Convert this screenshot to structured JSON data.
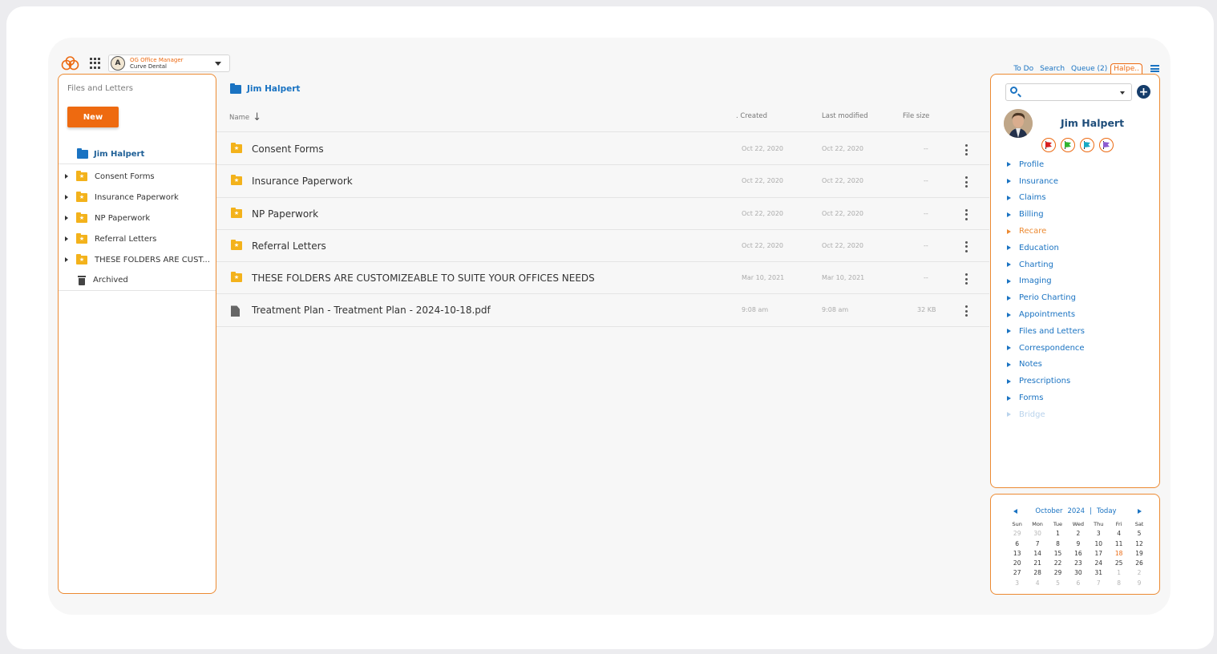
{
  "header": {
    "user_role": "OG Office Manager",
    "user_org": "Curve Dental",
    "avatar_initial": "A"
  },
  "top_links": {
    "todo": "To Do",
    "search": "Search",
    "queue": "Queue (2)",
    "patient_tab": "Halpe.."
  },
  "sidebar": {
    "title": "Files and Letters",
    "new_button": "New",
    "root": "Jim Halpert",
    "items": [
      {
        "label": "Consent Forms",
        "icon": "folder-star-icon"
      },
      {
        "label": "Insurance Paperwork",
        "icon": "folder-star-icon"
      },
      {
        "label": "NP Paperwork",
        "icon": "folder-star-icon"
      },
      {
        "label": "Referral Letters",
        "icon": "folder-star-icon"
      },
      {
        "label": "THESE FOLDERS ARE CUST...",
        "icon": "folder-star-icon"
      },
      {
        "label": "Archived",
        "icon": "trash-icon"
      }
    ]
  },
  "main": {
    "title": "Jim Halpert",
    "columns": {
      "name": "Name",
      "created": ". Created",
      "modified": "Last modified",
      "size": "File size"
    },
    "rows": [
      {
        "name": "Consent Forms",
        "created": "Oct 22, 2020",
        "modified": "Oct 22, 2020",
        "size": "--",
        "type": "folder"
      },
      {
        "name": "Insurance Paperwork",
        "created": "Oct 22, 2020",
        "modified": "Oct 22, 2020",
        "size": "--",
        "type": "folder"
      },
      {
        "name": "NP Paperwork",
        "created": "Oct 22, 2020",
        "modified": "Oct 22, 2020",
        "size": "--",
        "type": "folder"
      },
      {
        "name": "Referral Letters",
        "created": "Oct 22, 2020",
        "modified": "Oct 22, 2020",
        "size": "--",
        "type": "folder"
      },
      {
        "name": "THESE FOLDERS ARE CUSTOMIZEABLE TO SUITE YOUR OFFICES NEEDS",
        "created": "Mar 10, 2021",
        "modified": "Mar 10, 2021",
        "size": "--",
        "type": "folder"
      },
      {
        "name": "Treatment Plan - Treatment Plan - 2024-10-18.pdf",
        "created": "9:08 am",
        "modified": "9:08 am",
        "size": "32 KB",
        "type": "file"
      }
    ]
  },
  "patient": {
    "name": "Jim Halpert",
    "flag_colors": [
      "#d81f1f",
      "#2fb52f",
      "#17a9c4",
      "#8c5bd1"
    ],
    "nav": [
      {
        "label": "Profile",
        "state": "normal"
      },
      {
        "label": "Insurance",
        "state": "normal"
      },
      {
        "label": "Claims",
        "state": "normal"
      },
      {
        "label": "Billing",
        "state": "normal"
      },
      {
        "label": "Recare",
        "state": "active"
      },
      {
        "label": "Education",
        "state": "normal"
      },
      {
        "label": "Charting",
        "state": "normal"
      },
      {
        "label": "Imaging",
        "state": "normal"
      },
      {
        "label": "Perio Charting",
        "state": "normal"
      },
      {
        "label": "Appointments",
        "state": "normal"
      },
      {
        "label": "Files and Letters",
        "state": "normal"
      },
      {
        "label": "Correspondence",
        "state": "normal"
      },
      {
        "label": "Notes",
        "state": "normal"
      },
      {
        "label": "Prescriptions",
        "state": "normal"
      },
      {
        "label": "Forms",
        "state": "normal"
      },
      {
        "label": "Bridge",
        "state": "disabled"
      }
    ]
  },
  "calendar": {
    "month": "October",
    "year": "2024",
    "separator": "|",
    "today_label": "Today",
    "dow": [
      "Sun",
      "Mon",
      "Tue",
      "Wed",
      "Thu",
      "Fri",
      "Sat"
    ],
    "weeks": [
      [
        [
          "29",
          "muted"
        ],
        [
          "30",
          "muted"
        ],
        [
          "1",
          ""
        ],
        [
          "2",
          ""
        ],
        [
          "3",
          ""
        ],
        [
          "4",
          ""
        ],
        [
          "5",
          ""
        ]
      ],
      [
        [
          "6",
          ""
        ],
        [
          "7",
          ""
        ],
        [
          "8",
          ""
        ],
        [
          "9",
          ""
        ],
        [
          "10",
          ""
        ],
        [
          "11",
          ""
        ],
        [
          "12",
          ""
        ]
      ],
      [
        [
          "13",
          ""
        ],
        [
          "14",
          ""
        ],
        [
          "15",
          ""
        ],
        [
          "16",
          ""
        ],
        [
          "17",
          ""
        ],
        [
          "18",
          "today"
        ],
        [
          "19",
          ""
        ]
      ],
      [
        [
          "20",
          ""
        ],
        [
          "21",
          ""
        ],
        [
          "22",
          ""
        ],
        [
          "23",
          ""
        ],
        [
          "24",
          ""
        ],
        [
          "25",
          ""
        ],
        [
          "26",
          ""
        ]
      ],
      [
        [
          "27",
          ""
        ],
        [
          "28",
          ""
        ],
        [
          "29",
          ""
        ],
        [
          "30",
          ""
        ],
        [
          "31",
          ""
        ],
        [
          "1",
          "muted"
        ],
        [
          "2",
          "muted"
        ]
      ],
      [
        [
          "3",
          "muted"
        ],
        [
          "4",
          "muted"
        ],
        [
          "5",
          "muted"
        ],
        [
          "6",
          "muted"
        ],
        [
          "7",
          "muted"
        ],
        [
          "8",
          "muted"
        ],
        [
          "9",
          "muted"
        ]
      ]
    ]
  },
  "colors": {
    "accent": "#ec6a12",
    "link": "#1a73c2",
    "panel_border": "#ec8a32",
    "folder": "#f3b21b"
  }
}
